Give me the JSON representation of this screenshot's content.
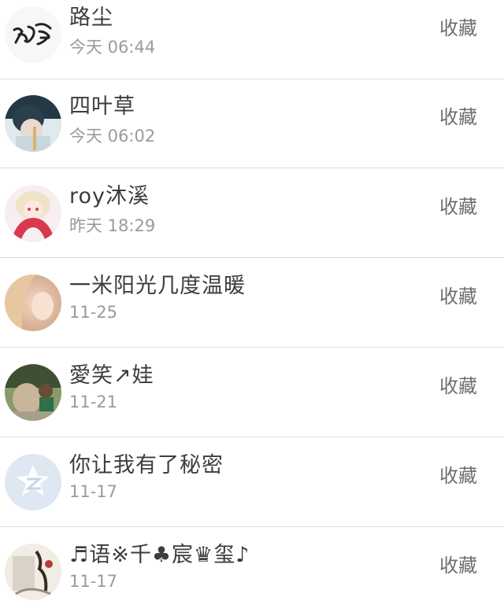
{
  "items": [
    {
      "name": "路尘",
      "time": "今天 06:44",
      "action": "收藏",
      "avatar": "calligraphy-avatar"
    },
    {
      "name": "四叶草",
      "time": "今天 06:02",
      "action": "收藏",
      "avatar": "photo-avatar"
    },
    {
      "name": "roy沐溪",
      "time": "昨天 18:29",
      "action": "收藏",
      "avatar": "anime-avatar"
    },
    {
      "name": "一米阳光几度温暖",
      "time": "11-25",
      "action": "收藏",
      "avatar": "portrait-avatar"
    },
    {
      "name": "愛笑↗娃",
      "time": "11-21",
      "action": "收藏",
      "avatar": "photo-avatar"
    },
    {
      "name": "你让我有了秘密",
      "time": "11-17",
      "action": "收藏",
      "avatar": "default-qzone-avatar"
    },
    {
      "name": "♬语※千♣宸♛玺♪",
      "time": "11-17",
      "action": "收藏",
      "avatar": "painting-avatar"
    }
  ]
}
